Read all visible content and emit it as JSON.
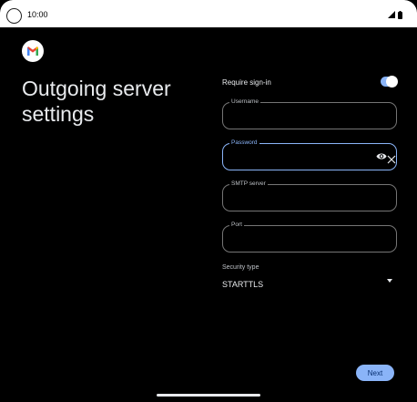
{
  "status_bar": {
    "time": "10:00"
  },
  "page": {
    "title": "Outgoing server settings"
  },
  "form": {
    "require_signin_label": "Require sign-in",
    "require_signin_on": true,
    "username_label": "Username",
    "password_label": "Password",
    "smtp_label": "SMTP server",
    "port_label": "Port",
    "security_label": "Security type",
    "security_value": "STARTTLS"
  },
  "actions": {
    "next_label": "Next"
  },
  "colors": {
    "accent": "#8ab4f8",
    "background": "#000000",
    "text": "#e8eaed"
  },
  "icons": [
    "gmail-logo-icon",
    "wifi-icon",
    "battery-icon",
    "eye-icon",
    "close-icon",
    "dropdown-arrow-icon"
  ]
}
